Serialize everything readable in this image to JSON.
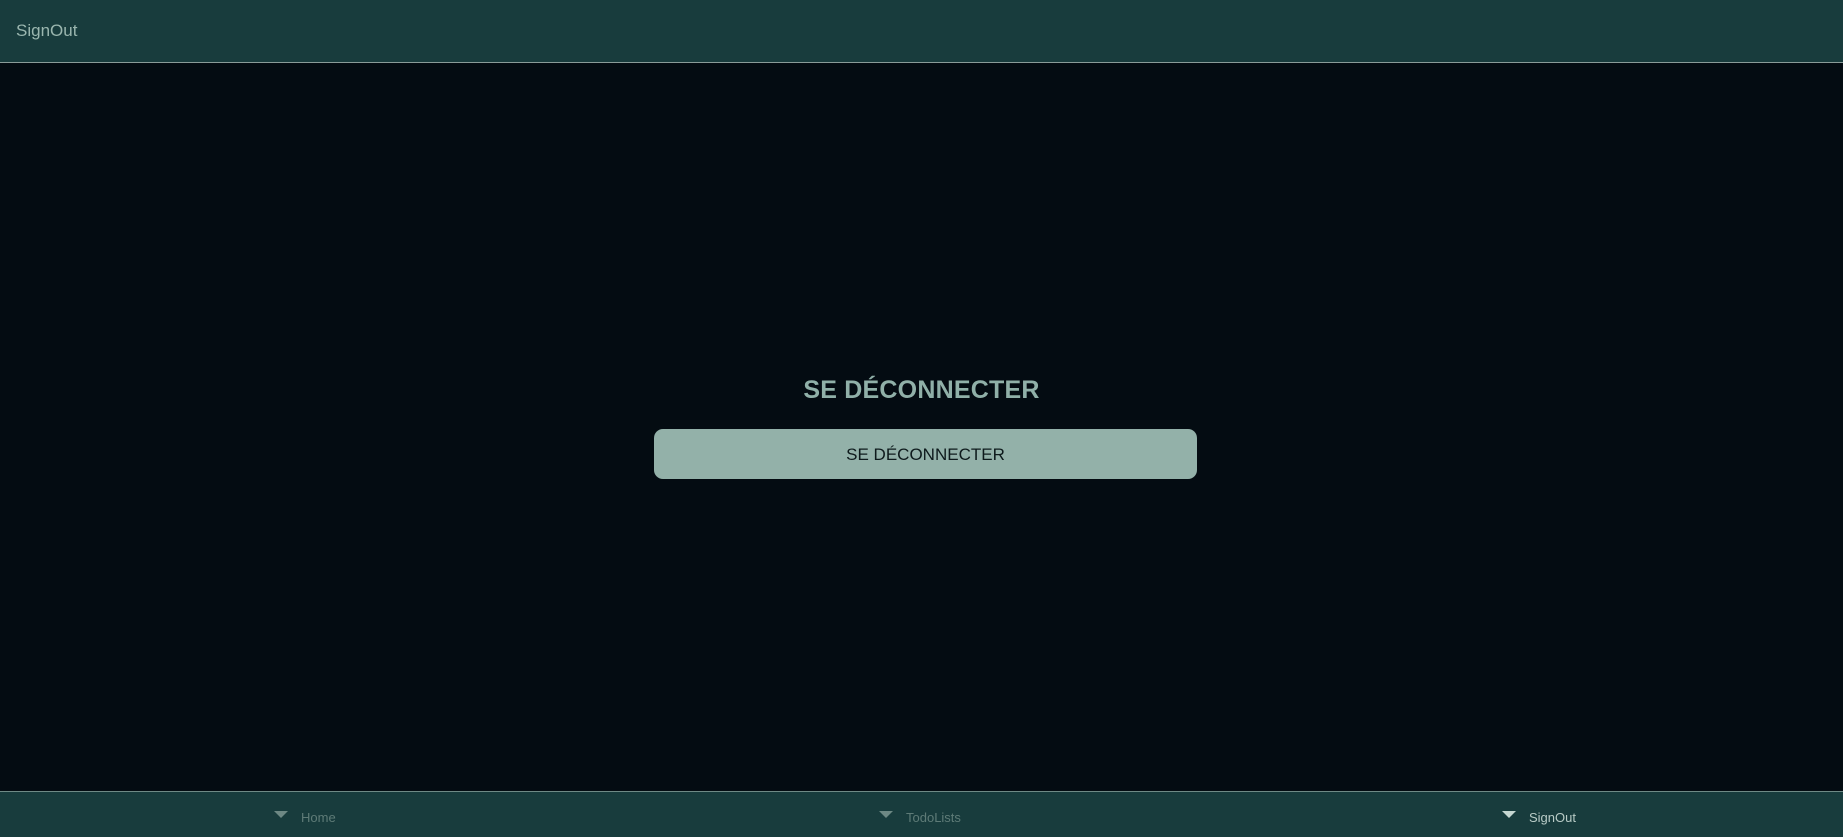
{
  "header": {
    "title": "SignOut"
  },
  "main": {
    "heading": "SE DÉCONNECTER",
    "button_label": "SE DÉCONNECTER"
  },
  "tabbar": {
    "tabs": [
      {
        "label": "Home",
        "icon": "caret-down-icon",
        "active": false
      },
      {
        "label": "TodoLists",
        "icon": "caret-down-icon",
        "active": false
      },
      {
        "label": "SignOut",
        "icon": "caret-down-icon",
        "active": true
      }
    ]
  },
  "colors": {
    "header_bg": "#183c3d",
    "page_bg": "#040c12",
    "accent": "#93b1a9"
  }
}
